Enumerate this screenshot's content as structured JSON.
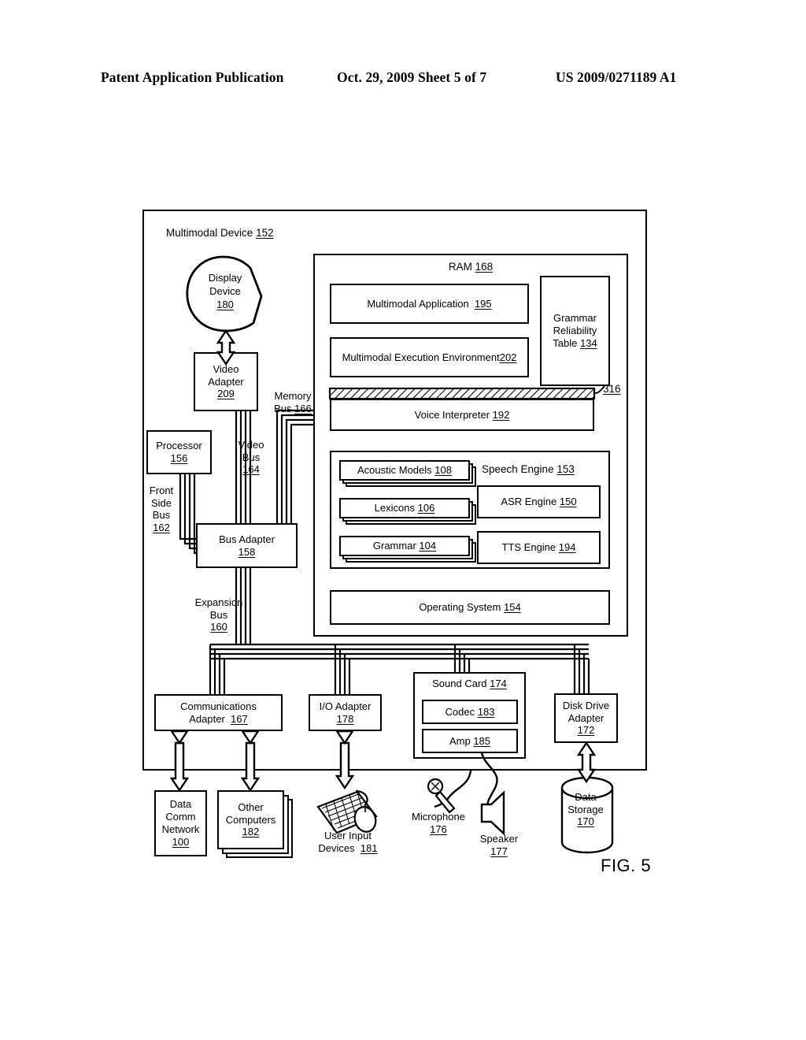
{
  "header": {
    "publication": "Patent Application Publication",
    "date_sheet": "Oct. 29, 2009  Sheet 5 of 7",
    "patent_number": "US 2009/0271189 A1"
  },
  "figure": {
    "label": "FIG. 5",
    "outer_title": "Multimodal Device",
    "outer_ref": "152"
  },
  "ram": {
    "title": "RAM",
    "ref": "168",
    "multimodal_application": {
      "label": "Multimodal Application",
      "ref": "195"
    },
    "multimodal_execution_environment": {
      "label": "Multimodal Execution Environment",
      "ref": "202"
    },
    "grammar_reliability_table": {
      "label": "Grammar Reliability Table",
      "line1": "Grammar",
      "line2": "Reliability",
      "line3": "Table",
      "ref": "134"
    },
    "voice_interpreter": {
      "label": "Voice Interpreter",
      "ref": "192"
    },
    "hatched_bar_callout": "316",
    "operating_system": {
      "label": "Operating System",
      "ref": "154"
    }
  },
  "speech_engine": {
    "title": "Speech Engine",
    "ref": "153",
    "acoustic_models": {
      "label": "Acoustic Models",
      "ref": "108"
    },
    "lexicons": {
      "label": "Lexicons",
      "ref": "106"
    },
    "grammar": {
      "label": "Grammar",
      "ref": "104"
    },
    "asr_engine": {
      "label": "ASR Engine",
      "ref": "150"
    },
    "tts_engine": {
      "label": "TTS Engine",
      "ref": "194"
    }
  },
  "hardware": {
    "display_device": {
      "line1": "Display",
      "line2": "Device",
      "ref": "180"
    },
    "video_adapter": {
      "line1": "Video",
      "line2": "Adapter",
      "ref": "209"
    },
    "processor": {
      "label": "Processor",
      "ref": "156"
    },
    "bus_adapter": {
      "label": "Bus Adapter",
      "ref": "158"
    },
    "communications_adapter": {
      "line1": "Communications",
      "line2": "Adapter",
      "ref": "167"
    },
    "io_adapter": {
      "label": "I/O Adapter",
      "ref": "178"
    },
    "sound_card": {
      "label": "Sound Card",
      "ref": "174"
    },
    "codec": {
      "label": "Codec",
      "ref": "183"
    },
    "amp": {
      "label": "Amp",
      "ref": "185"
    },
    "disk_drive_adapter": {
      "line1": "Disk Drive",
      "line2": "Adapter",
      "ref": "172"
    }
  },
  "buses": {
    "memory_bus": {
      "line1": "Memory",
      "line2": "Bus",
      "ref": "166"
    },
    "video_bus": {
      "line1": "Video",
      "line2": "Bus",
      "ref": "164"
    },
    "front_side_bus": {
      "line1": "Front",
      "line2": "Side",
      "line3": "Bus",
      "ref": "162"
    },
    "expansion_bus": {
      "line1": "Expansion",
      "line2": "Bus",
      "ref": "160"
    }
  },
  "peripherals": {
    "data_comm_network": {
      "line1": "Data",
      "line2": "Comm",
      "line3": "Network",
      "ref": "100"
    },
    "other_computers": {
      "line1": "Other",
      "line2": "Computers",
      "ref": "182"
    },
    "user_input_devices": {
      "line1": "User Input",
      "line2": "Devices",
      "ref": "181"
    },
    "microphone": {
      "label": "Microphone",
      "ref": "176"
    },
    "speaker": {
      "label": "Speaker",
      "ref": "177"
    },
    "data_storage": {
      "line1": "Data",
      "line2": "Storage",
      "ref": "170"
    }
  }
}
